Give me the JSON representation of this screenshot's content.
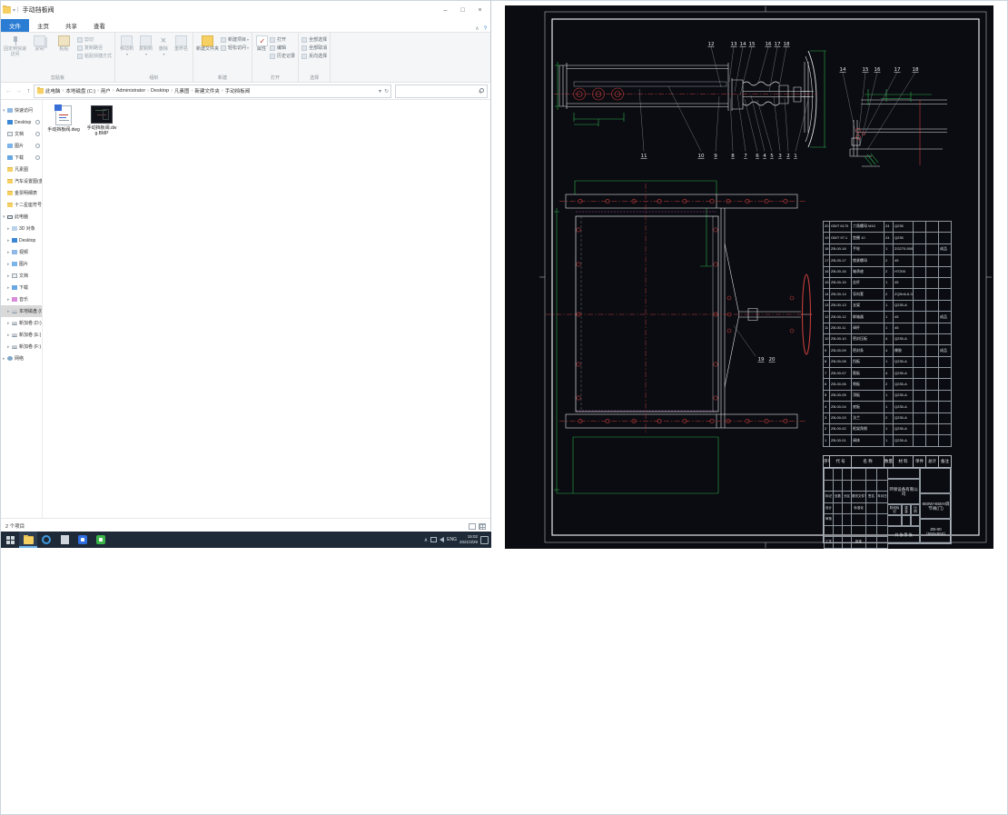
{
  "icons": {
    "dropdown": "▾",
    "chev": "▸",
    "chev_open": "▾",
    "cross": "×",
    "check": "✓",
    "tray_expand": "∧"
  },
  "window": {
    "title": "手动挡板阀",
    "min": "–",
    "max": "□",
    "close": "×"
  },
  "tabs": {
    "file": "文件",
    "home": "主页",
    "share": "共享",
    "view": "查看",
    "help": "?",
    "collapse": "∧"
  },
  "ribbon": {
    "clipboard": {
      "pin": "固定到快速访问",
      "copy": "复制",
      "paste": "粘贴",
      "cut": "剪切",
      "copy_path": "复制路径",
      "paste_shortcut": "粘贴快捷方式",
      "group": "剪贴板"
    },
    "organize": {
      "move": "移动到",
      "copy_to": "复制到",
      "del": "删除",
      "rename": "重命名",
      "group": "组织"
    },
    "new": {
      "folder": "新建文件夹",
      "item": "新建项目",
      "easy": "轻松访问",
      "group": "新建"
    },
    "open": {
      "props": "属性",
      "open": "打开",
      "edit": "编辑",
      "history": "历史记录",
      "group": "打开"
    },
    "select": {
      "all": "全部选择",
      "none": "全部取消",
      "invert": "反向选择",
      "group": "选择"
    }
  },
  "address": {
    "crumbs": [
      "此电脑",
      "本地磁盘 (C:)",
      "用户",
      "Administrator",
      "Desktop",
      "凡素图",
      "新建文件夹",
      "手动挡板阀"
    ],
    "sep": "›",
    "back": "←",
    "fwd": "→",
    "up": "↑",
    "refresh": "↻",
    "dd": "▾"
  },
  "sidebar": {
    "quick": {
      "header": "快速访问",
      "items": [
        "Desktop",
        "文档",
        "图片",
        "下载",
        "凡素图",
        "汽车设置图(金票)",
        "金票明细表",
        "十二星座符号"
      ]
    },
    "pc": {
      "header": "此电脑",
      "items": [
        "3D 对象",
        "Desktop",
        "视频",
        "图片",
        "文档",
        "下载",
        "音乐",
        "本地磁盘 (C:)",
        "新加卷 (D:)",
        "新加卷 (E:)",
        "新加卷 (F:)"
      ]
    },
    "network": "网络"
  },
  "files": [
    {
      "name": "手动挡板阀.dwg"
    },
    {
      "name": "手动挡板阀.dwg.BMP"
    }
  ],
  "status": {
    "count": "2 个项目"
  },
  "taskbar": {
    "lang": "ENG",
    "time": "15:02",
    "date": "2021/3/29"
  },
  "cad": {
    "balloons": {
      "top": [
        "12",
        "13",
        "14",
        "15",
        "16",
        "17",
        "18"
      ],
      "bottom": [
        "11",
        "10",
        "9",
        "8",
        "7",
        "6",
        "4",
        "5",
        "3",
        "2",
        "1"
      ],
      "detail": [
        "14",
        "15",
        "16",
        "17",
        "18"
      ],
      "plan": [
        "19",
        "20"
      ]
    },
    "bom": {
      "header": [
        [
          "序号",
          "代  号",
          "名  称",
          "数量",
          "材 料",
          "单件",
          "总计",
          "备注"
        ]
      ],
      "rows": [
        [
          "20",
          "GB/T 6170",
          "六角螺母 M10",
          "24",
          "Q235",
          "",
          "",
          ""
        ],
        [
          "19",
          "GB/T 97.1",
          "垫圈 10",
          "24",
          "Q235",
          "",
          "",
          ""
        ],
        [
          "18",
          "ZB-00-18",
          "手轮",
          "1",
          "ZG270-500",
          "",
          "",
          "成品"
        ],
        [
          "17",
          "ZB-00-17",
          "锁紧螺母",
          "2",
          "45",
          "",
          "",
          ""
        ],
        [
          "16",
          "ZB-00-16",
          "轴承座",
          "2",
          "HT200",
          "",
          "",
          ""
        ],
        [
          "15",
          "ZB-00-15",
          "丝杆",
          "1",
          "45",
          "",
          "",
          ""
        ],
        [
          "14",
          "ZB-00-14",
          "导向套",
          "2",
          "ZQSn6-6-3",
          "",
          "",
          ""
        ],
        [
          "13",
          "ZB-00-13",
          "支架",
          "1",
          "Q235-A",
          "",
          "",
          ""
        ],
        [
          "12",
          "ZB-00-12",
          "联轴器",
          "1",
          "45",
          "",
          "",
          "成品"
        ],
        [
          "11",
          "ZB-00-11",
          "阀杆",
          "1",
          "45",
          "",
          "",
          ""
        ],
        [
          "10",
          "ZB-00-10",
          "密封压板",
          "4",
          "Q235-A",
          "",
          "",
          ""
        ],
        [
          "9",
          "ZB-00-09",
          "密封条",
          "4",
          "橡胶",
          "",
          "",
          "成品"
        ],
        [
          "8",
          "ZB-00-08",
          "挡板",
          "1",
          "Q235-A",
          "",
          "",
          ""
        ],
        [
          "7",
          "ZB-00-07",
          "筋板",
          "4",
          "Q235-A",
          "",
          "",
          ""
        ],
        [
          "6",
          "ZB-00-06",
          "侧板",
          "2",
          "Q235-A",
          "",
          "",
          ""
        ],
        [
          "5",
          "ZB-00-05",
          "顶板",
          "1",
          "Q235-A",
          "",
          "",
          ""
        ],
        [
          "4",
          "ZB-00-04",
          "底板",
          "1",
          "Q235-A",
          "",
          "",
          ""
        ],
        [
          "3",
          "ZB-00-03",
          "法兰",
          "2",
          "Q235-A",
          "",
          "",
          ""
        ],
        [
          "2",
          "ZB-00-02",
          "框架角钢",
          "1",
          "Q235-A",
          "",
          "",
          ""
        ],
        [
          "1",
          "ZB-00-01",
          "阀体",
          "1",
          "Q235-A",
          "",
          "",
          ""
        ]
      ]
    },
    "tb": {
      "left": [
        [
          "",
          "",
          "",
          "",
          "",
          ""
        ],
        [
          "",
          "",
          "",
          "",
          "",
          ""
        ],
        [
          "标记",
          "处数",
          "分区",
          "更改文件号",
          "签名",
          "年月日"
        ],
        [
          "设计",
          "",
          "",
          "标准化",
          "",
          ""
        ],
        [
          "审核",
          "",
          "",
          "",
          "",
          ""
        ],
        [
          "",
          "",
          "",
          "",
          "",
          ""
        ],
        [
          "工艺",
          "",
          "",
          "批准",
          "",
          ""
        ]
      ],
      "stage": [
        "阶段标记",
        "重量",
        "比例"
      ],
      "company": "环保设备有限公司",
      "title": "650W×650H调节阀(门)",
      "no": "ZB-00（650×650）",
      "sheets": "共 张  第 张"
    }
  }
}
